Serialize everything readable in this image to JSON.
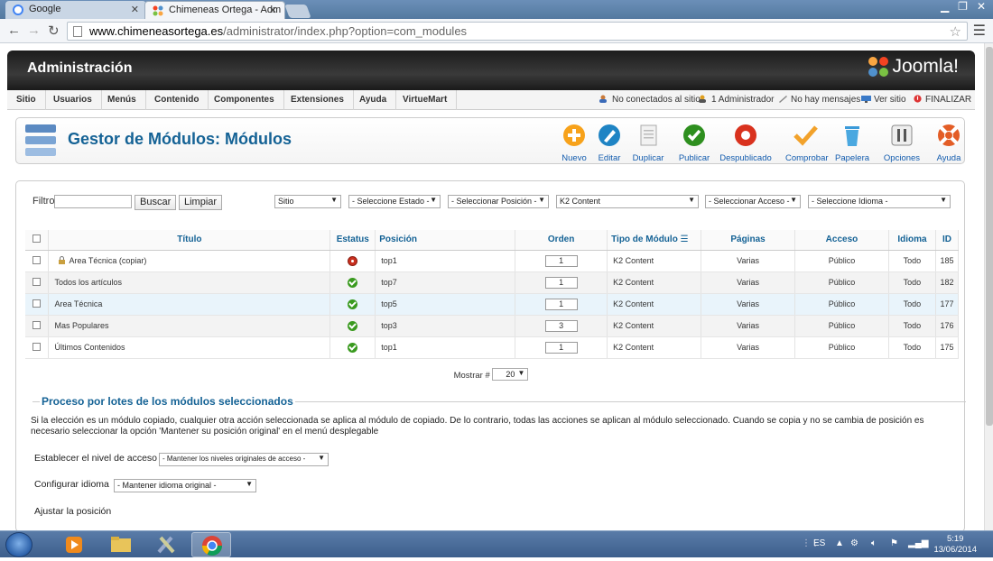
{
  "browser": {
    "tabs": [
      {
        "label": "Google",
        "active": false
      },
      {
        "label": "Chimeneas Ortega - Adm",
        "active": true
      }
    ],
    "url_domain": "www.chimeneasortega.es",
    "url_path": "/administrator/index.php?option=com_modules"
  },
  "admin": {
    "title": "Administración",
    "logo_text": "Joomla!",
    "menu": [
      "Sitio",
      "Usuarios",
      "Menús",
      "Contenido",
      "Componentes",
      "Extensiones",
      "Ayuda",
      "VirtueMart"
    ],
    "status": {
      "not_connected": "No conectados al sitio",
      "admins": "1 Administrador",
      "messages": "No hay mensajes",
      "view_site": "Ver sitio",
      "logout": "FINALIZAR"
    }
  },
  "page": {
    "title": "Gestor de Módulos: Módulos",
    "toolbar": [
      "Nuevo",
      "Editar",
      "Duplicar",
      "Publicar",
      "Despublicado",
      "Comprobar",
      "Papelera",
      "Opciones",
      "Ayuda"
    ]
  },
  "filter": {
    "label": "Filtro:",
    "search_button": "Buscar",
    "clear_button": "Limpiar",
    "selects": [
      "Sitio",
      "- Seleccione Estado -",
      "- Seleccionar Posición -",
      "K2 Content",
      "- Seleccionar Acceso -",
      "- Seleccione Idioma -"
    ]
  },
  "table": {
    "headers": [
      "Título",
      "Estatus",
      "Posición",
      "Orden",
      "Tipo de Módulo",
      "Páginas",
      "Acceso",
      "Idioma",
      "ID"
    ],
    "rows": [
      {
        "title": "Area Técnica (copiar)",
        "locked": true,
        "published": false,
        "position": "top1",
        "order": "1",
        "type": "K2 Content",
        "pages": "Varias",
        "access": "Público",
        "lang": "Todo",
        "id": "185"
      },
      {
        "title": "Todos los artículos",
        "locked": false,
        "published": true,
        "position": "top7",
        "order": "1",
        "type": "K2 Content",
        "pages": "Varias",
        "access": "Público",
        "lang": "Todo",
        "id": "182"
      },
      {
        "title": "Area Técnica",
        "locked": false,
        "published": true,
        "position": "top5",
        "order": "1",
        "type": "K2 Content",
        "pages": "Varias",
        "access": "Público",
        "lang": "Todo",
        "id": "177"
      },
      {
        "title": "Mas Populares",
        "locked": false,
        "published": true,
        "position": "top3",
        "order": "3",
        "type": "K2 Content",
        "pages": "Varias",
        "access": "Público",
        "lang": "Todo",
        "id": "176"
      },
      {
        "title": "Últimos Contenidos",
        "locked": false,
        "published": true,
        "position": "top1",
        "order": "1",
        "type": "K2 Content",
        "pages": "Varias",
        "access": "Público",
        "lang": "Todo",
        "id": "175"
      }
    ],
    "show_label": "Mostrar #",
    "show_value": "20"
  },
  "batch": {
    "legend": "Proceso por lotes de los módulos seleccionados",
    "description": "Si la elección es un módulo copiado, cualquier otra acción seleccionada se aplica al módulo de copiado. De lo contrario, todas las acciones se aplican al módulo seleccionado. Cuando se copia y no se cambia de posición es necesario seleccionar la opción 'Mantener su posición original' en el menú desplegable",
    "access_label": "Establecer el nivel de acceso",
    "access_value": "- Mantener los niveles originales de acceso -",
    "lang_label": "Configurar idioma",
    "lang_value": "- Mantener idioma original -",
    "position_label": "Ajustar la posición"
  },
  "taskbar": {
    "lang": "ES",
    "time": "5:19",
    "date": "13/06/2014"
  }
}
